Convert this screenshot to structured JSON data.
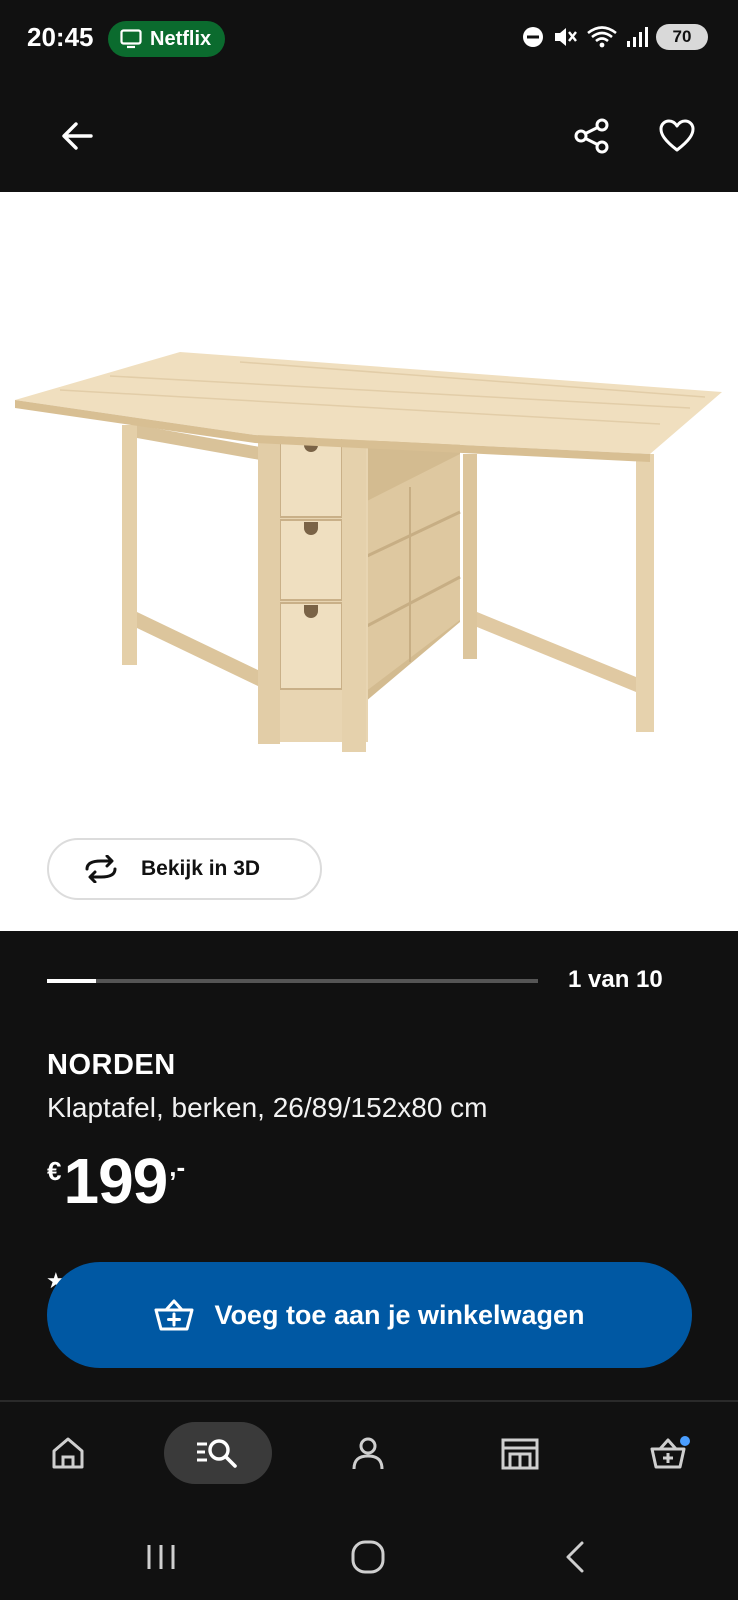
{
  "status_bar": {
    "time": "20:45",
    "notification_app": "Netflix",
    "battery": "70"
  },
  "header": {
    "back_icon": "arrow-left-icon",
    "share_icon": "share-icon",
    "favorite_icon": "heart-icon"
  },
  "gallery": {
    "view_3d_label": "Bekijk in 3D",
    "counter_label": "1 van 10",
    "current_index": 1,
    "total": 10
  },
  "product": {
    "name": "NORDEN",
    "description": "Klaptafel, berken, 26/89/152x80 cm",
    "price_currency": "€",
    "price_amount": "199",
    "price_suffix": ",-"
  },
  "actions": {
    "add_to_cart_label": "Voeg toe aan je winkelwagen"
  },
  "bottom_nav": {
    "items": [
      {
        "name": "home",
        "icon": "home-icon"
      },
      {
        "name": "search",
        "icon": "search-list-icon",
        "active": true
      },
      {
        "name": "account",
        "icon": "person-icon"
      },
      {
        "name": "store",
        "icon": "store-icon"
      },
      {
        "name": "cart",
        "icon": "basket-icon",
        "badge": true
      }
    ]
  },
  "colors": {
    "background": "#111111",
    "primary_blue": "#0058a3",
    "netflix_green": "#0b6b2e",
    "badge_blue": "#4a9eff"
  }
}
